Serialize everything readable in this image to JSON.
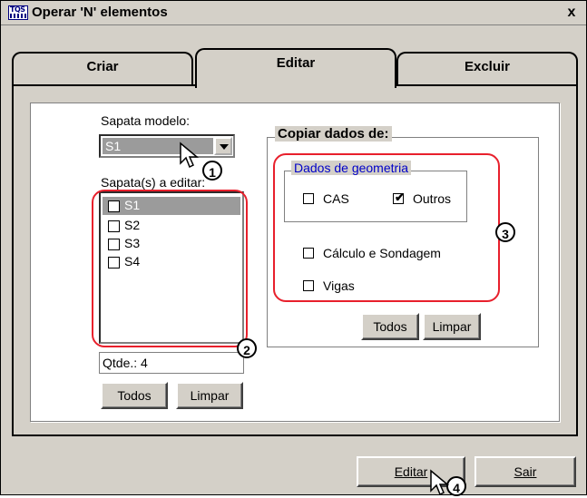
{
  "window": {
    "icon_text": "TQS",
    "title": "Operar 'N' elementos",
    "close_glyph": "x"
  },
  "tabs": [
    {
      "label": "Criar",
      "active": false
    },
    {
      "label": "Editar",
      "active": true
    },
    {
      "label": "Excluir",
      "active": false
    }
  ],
  "left": {
    "model_label": "Sapata modelo:",
    "model_value": "S1",
    "edit_label": "Sapata(s) a editar:",
    "items": [
      {
        "label": "S1",
        "checked": false,
        "selected": true
      },
      {
        "label": "S2",
        "checked": false,
        "selected": false
      },
      {
        "label": "S3",
        "checked": false,
        "selected": false
      },
      {
        "label": "S4",
        "checked": false,
        "selected": false
      }
    ],
    "count": "Qtde.: 4",
    "all_button": "Todos",
    "clear_button": "Limpar"
  },
  "copy": {
    "title": "Copiar dados de:",
    "geometry_title": "Dados de geometria",
    "cas_label": "CAS",
    "cas_checked": false,
    "outros_label": "Outros",
    "outros_checked": true,
    "calc_label": "Cálculo e Sondagem",
    "calc_checked": false,
    "vigas_label": "Vigas",
    "vigas_checked": false,
    "all_button": "Todos",
    "clear_button": "Limpar"
  },
  "footer": {
    "edit_button": "Editar",
    "exit_button": "Sair"
  },
  "markers": [
    "1",
    "2",
    "3",
    "4"
  ],
  "colors": {
    "highlight": "#e8202c",
    "selection": "#9b9b9b",
    "dialog": "#d4d0c8",
    "group_title": "#0000c8"
  }
}
